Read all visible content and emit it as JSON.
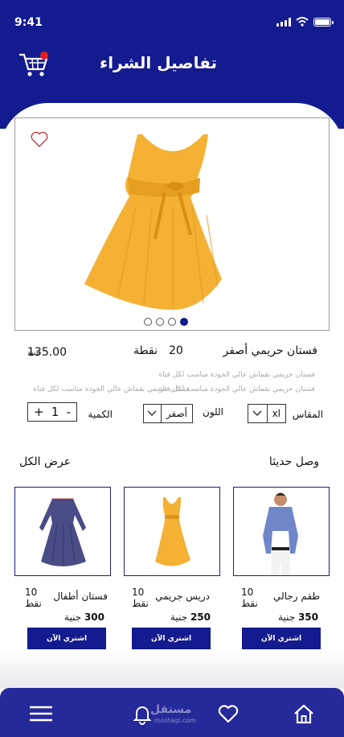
{
  "status": {
    "time": "9:41"
  },
  "header": {
    "title": "تفاصيل الشراء",
    "cart_icon": "cart-icon",
    "accent": "#131b8e",
    "badge_color": "#e31c1c"
  },
  "product": {
    "name": "فستان حريمي أصفر",
    "points_value": "20",
    "points_label": "نقطة",
    "price_value": "135.00",
    "price_currency": "جنية",
    "description_lines": [
      "فستان حريمي بقماش عالي الجودة مناسب لكل فتاة",
      "فستان حريمي بقماش عالي الجودة مناسب لكل فتاة",
      "فستان حريمي بقماش عالي الجودة مناسب لكل فتاة"
    ],
    "carousel": {
      "count": 4,
      "active": 4
    }
  },
  "options": {
    "size_label": "المقاس",
    "size_value": "xl",
    "color_label": "اللون",
    "color_value": "أصفر",
    "quantity_label": "الكمية",
    "quantity_value": "1",
    "minus": "-",
    "plus": "+"
  },
  "sections": {
    "new_arrivals": "وصل حديثا",
    "view_all": "عرض الكل"
  },
  "cards": [
    {
      "name": "طقم رجالي",
      "points": "10",
      "points_unit": "نقط",
      "price": "350",
      "currency": "جنية",
      "buy": "اشتري الآن"
    },
    {
      "name": "دريس جريمي",
      "points": "10",
      "points_unit": "نقط",
      "price": "250",
      "currency": "جنية",
      "buy": "اشتري الآن"
    },
    {
      "name": "فستان أطفال",
      "points": "10",
      "points_unit": "نقط",
      "price": "300",
      "currency": "جنية",
      "buy": "اشتري الآن"
    }
  ],
  "bottom_nav": {
    "icons": [
      "home-icon",
      "heart-icon",
      "bell-icon",
      "menu-icon"
    ],
    "watermark": "مستقل",
    "watermark_sub": "mostaql.com"
  }
}
